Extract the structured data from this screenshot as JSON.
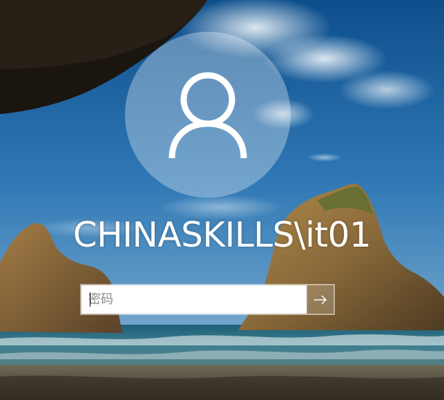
{
  "user": {
    "account_name": "CHINASKILLS\\it01",
    "avatar_icon": "user-silhouette-icon"
  },
  "password": {
    "value": "",
    "placeholder": "密码"
  },
  "submit": {
    "icon": "arrow-right-icon"
  },
  "colors": {
    "sky": "#2a6aa6",
    "text": "#ffffff"
  }
}
